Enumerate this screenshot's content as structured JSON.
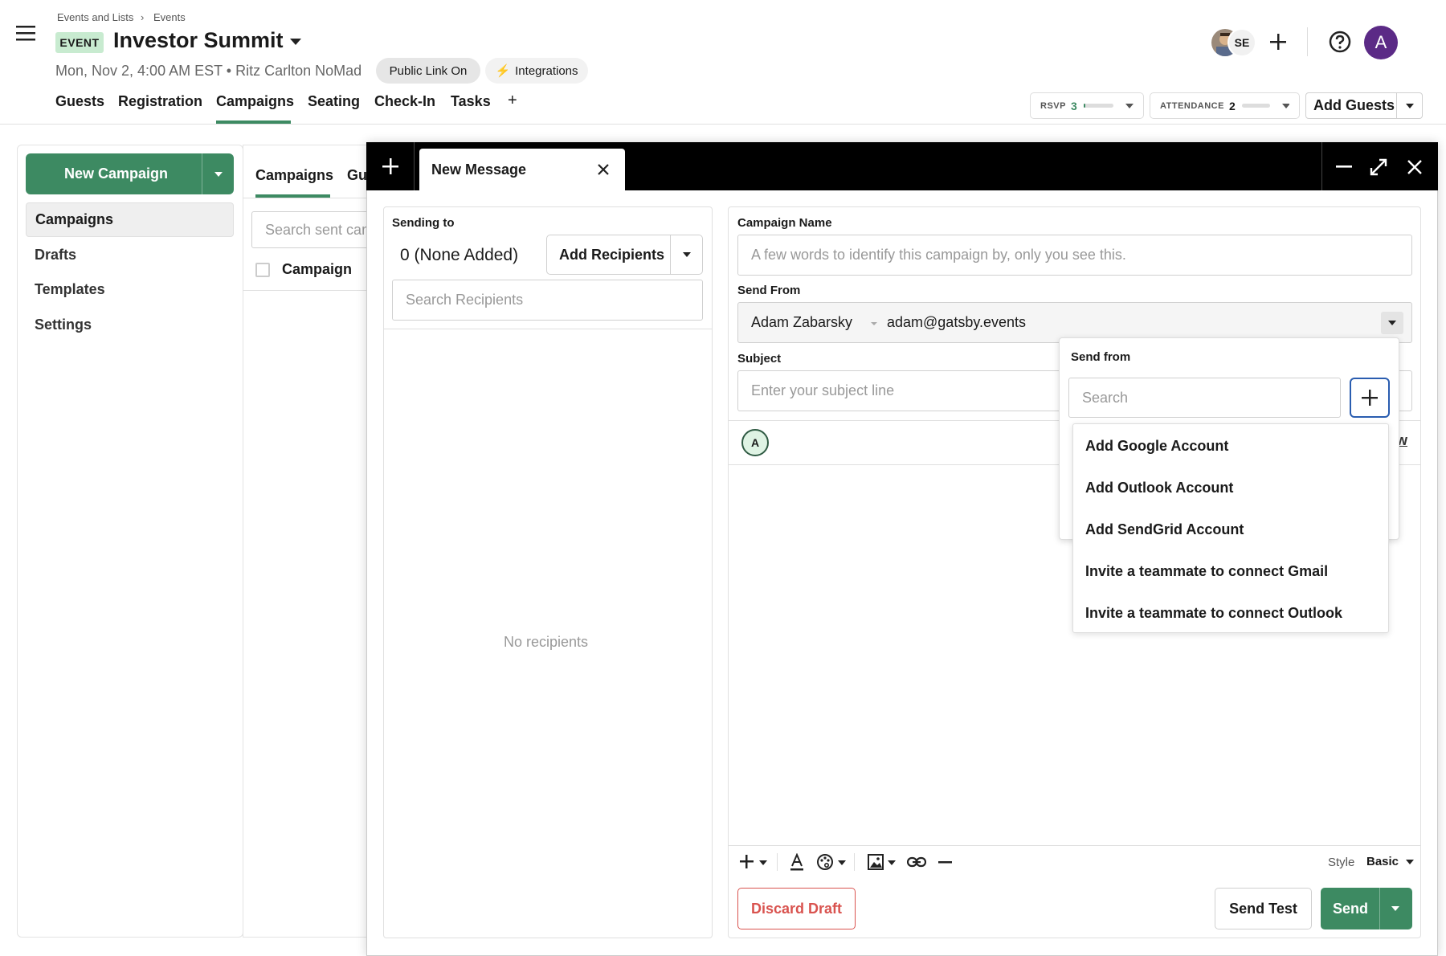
{
  "header": {
    "breadcrumb": [
      "Events and Lists",
      "Events"
    ],
    "event_badge": "EVENT",
    "event_title": "Investor Summit",
    "date_time": "Mon, Nov 2, 4:00 AM EST",
    "venue": "Ritz Carlton NoMad",
    "public_link": "Public Link On",
    "integrations": "Integrations",
    "collaborator_initials": "SE",
    "user_initial": "A"
  },
  "nav": {
    "tabs": [
      "Guests",
      "Registration",
      "Campaigns",
      "Seating",
      "Check-In",
      "Tasks"
    ],
    "active": "Campaigns",
    "add_label": "+"
  },
  "stats": {
    "rsvp_label": "RSVP",
    "rsvp_value": "3",
    "rsvp_progress": 0.05,
    "attendance_label": "ATTENDANCE",
    "attendance_value": "2",
    "attendance_progress": 0.0
  },
  "add_guests": "Add Guests",
  "sidebar": {
    "new_campaign": "New Campaign",
    "items": [
      "Campaigns",
      "Drafts",
      "Templates",
      "Settings"
    ],
    "selected": "Campaigns"
  },
  "middle": {
    "tabs": [
      "Campaigns",
      "Gu"
    ],
    "search_placeholder": "Search sent campaigns",
    "column_header": "Campaign"
  },
  "modal": {
    "tab_title": "New Message",
    "recipients": {
      "label": "Sending to",
      "count_text": "0 (None Added)",
      "add_button": "Add Recipients",
      "search_placeholder": "Search Recipients",
      "empty_text": "No recipients"
    },
    "form": {
      "campaign_name_label": "Campaign Name",
      "campaign_name_placeholder": "A few words to identify this campaign by, only you see this.",
      "send_from_label": "Send From",
      "sender_name": "Adam Zabarsky",
      "sender_email": "adam@gatsby.events",
      "subject_label": "Subject",
      "subject_placeholder": "Enter your subject line",
      "avatar_initial": "A",
      "preview_fragment": "w"
    },
    "send_from_dropdown": {
      "title": "Send from",
      "search_placeholder": "Search",
      "options": [
        "Add Google Account",
        "Add Outlook Account",
        "Add SendGrid Account",
        "Invite a teammate to connect Gmail",
        "Invite a teammate to connect Outlook"
      ]
    },
    "toolbar": {
      "style_label": "Style",
      "style_value": "Basic"
    },
    "footer": {
      "discard": "Discard Draft",
      "send_test": "Send Test",
      "send": "Send"
    }
  },
  "colors": {
    "accent_green": "#3d8a62",
    "purple_avatar": "#5b2a86",
    "discard_red": "#d9534f",
    "badge_green": "#c8ebd0"
  }
}
